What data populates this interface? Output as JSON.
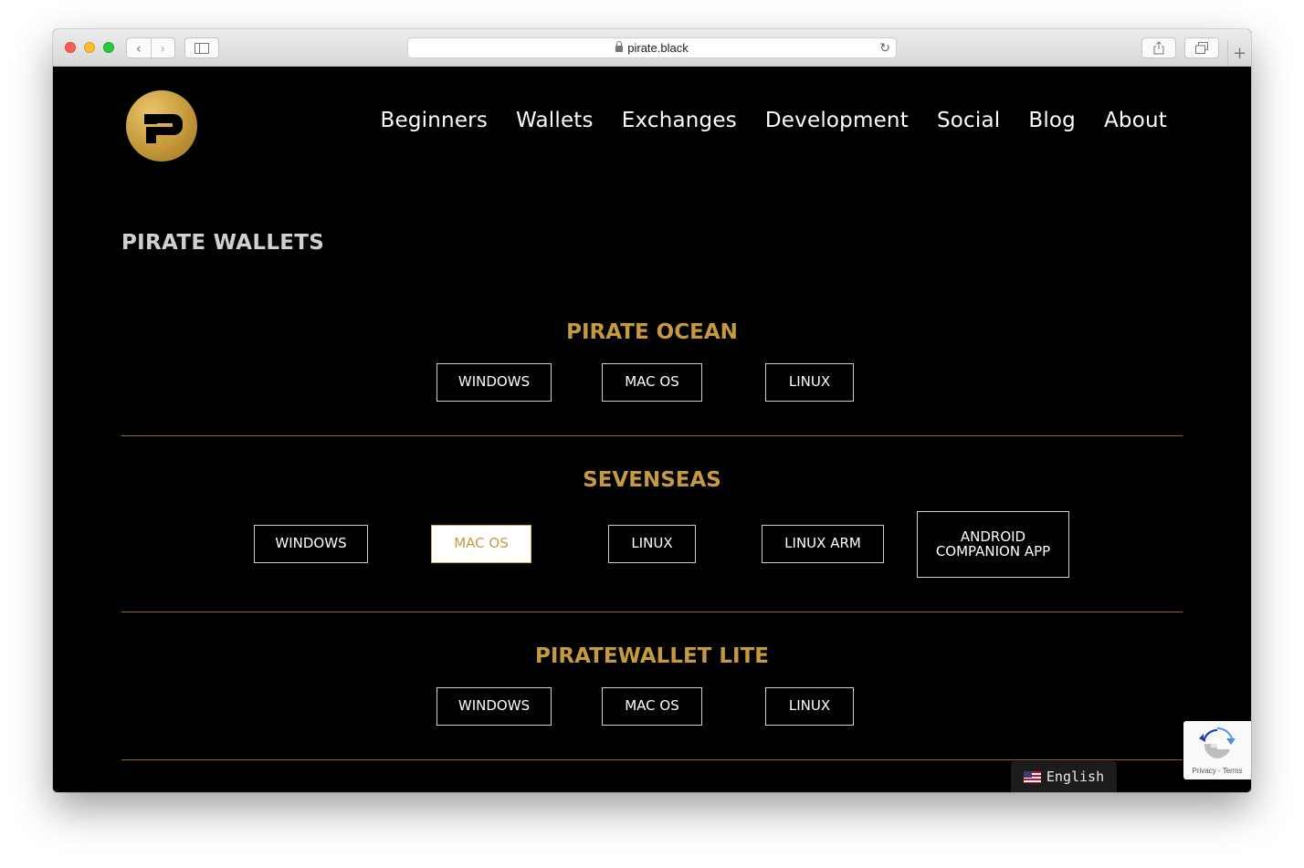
{
  "browser": {
    "url": "pirate.black",
    "new_tab_symbol": "+"
  },
  "nav": {
    "items": [
      "Beginners",
      "Wallets",
      "Exchanges",
      "Development",
      "Social",
      "Blog",
      "About"
    ]
  },
  "page": {
    "title": "PIRATE WALLETS"
  },
  "sections": [
    {
      "title": "PIRATE OCEAN",
      "buttons": [
        "WINDOWS",
        "MAC OS",
        "LINUX"
      ]
    },
    {
      "title": "SEVENSEAS",
      "buttons": [
        "WINDOWS",
        "MAC OS",
        "LINUX",
        "LINUX ARM",
        "ANDROID COMPANION APP"
      ]
    },
    {
      "title": "PIRATEWALLET LITE",
      "buttons": [
        "WINDOWS",
        "MAC OS",
        "LINUX"
      ]
    }
  ],
  "language": {
    "label": "English",
    "flag_icon": "us-flag-icon"
  },
  "recaptcha": {
    "links": "Privacy - Terms"
  },
  "colors": {
    "accent_gold": "#c59a3e",
    "background": "#000000",
    "text": "#ffffff"
  }
}
